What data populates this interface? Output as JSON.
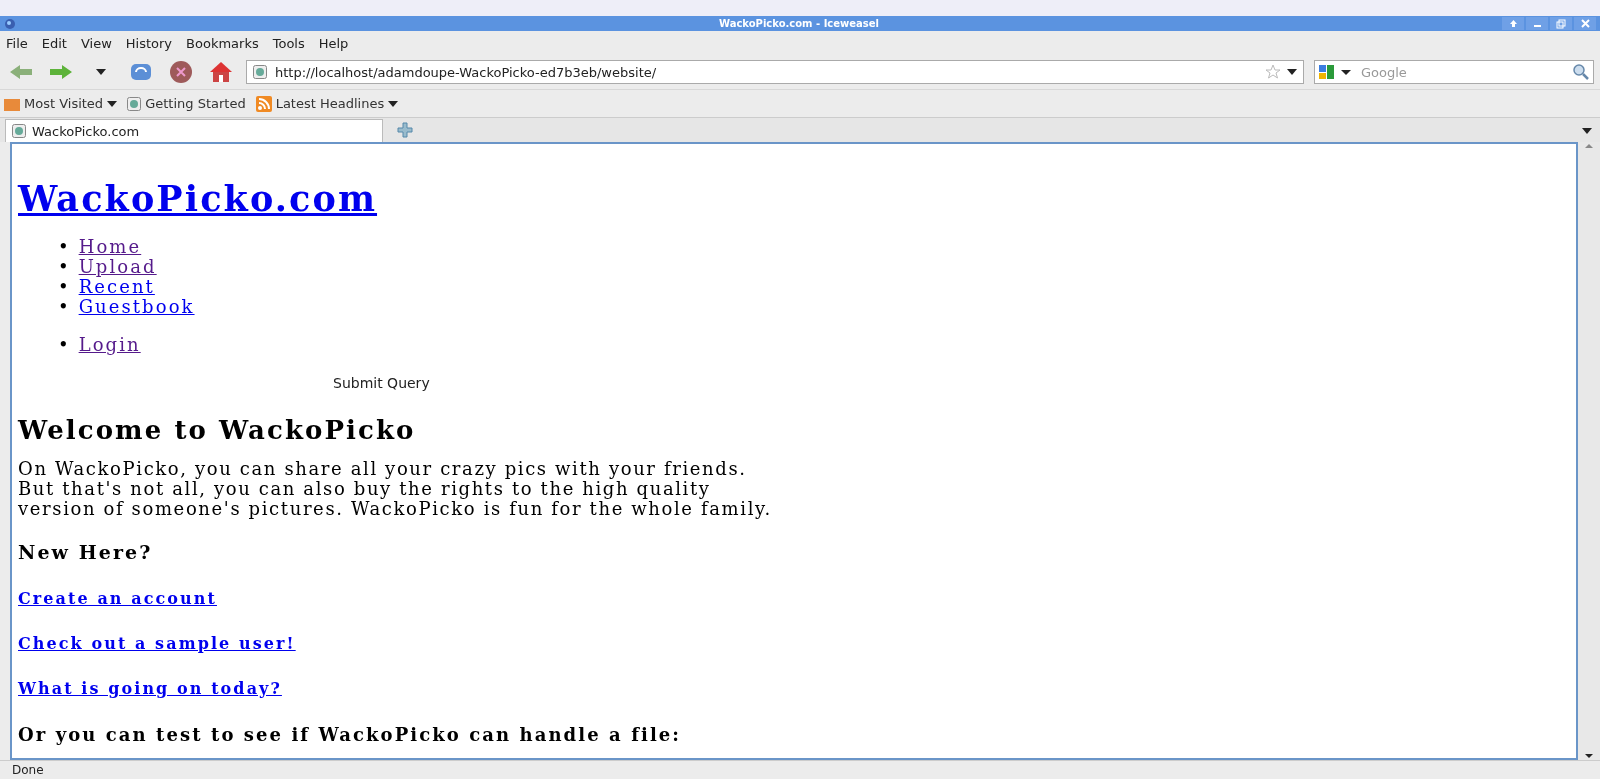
{
  "window": {
    "title": "WackoPicko.com - Iceweasel"
  },
  "menu": [
    "File",
    "Edit",
    "View",
    "History",
    "Bookmarks",
    "Tools",
    "Help"
  ],
  "address": {
    "value": "http://localhost/adamdoupe-WackoPicko-ed7b3eb/website/"
  },
  "search": {
    "placeholder": "Google"
  },
  "bookmarks": [
    {
      "label": "Most Visited",
      "kind": "folder"
    },
    {
      "label": "Getting Started",
      "kind": "page"
    },
    {
      "label": "Latest Headlines",
      "kind": "feed"
    }
  ],
  "tabs": [
    {
      "label": "WackoPicko.com",
      "selected": true
    }
  ],
  "page": {
    "site_title": "WackoPicko.com",
    "nav": [
      {
        "bullet": "•",
        "label": "Home",
        "visited": true
      },
      {
        "bullet": "•",
        "label": "Upload",
        "visited": true
      },
      {
        "bullet": "•",
        "label": "Recent",
        "visited": false
      },
      {
        "bullet": "•",
        "label": "Guestbook",
        "visited": false
      }
    ],
    "login": [
      {
        "bullet": "•",
        "label": "Login",
        "visited": true
      }
    ],
    "submit_button": "Submit Query",
    "heading": "Welcome to WackoPicko",
    "intro": [
      "On WackoPicko, you can share all your crazy pics with your friends.",
      "But that's not all, you can also buy the rights to the high quality",
      "version of someone's pictures. WackoPicko is fun for the whole family."
    ],
    "new_here": "New Here?",
    "links": [
      "Create an account",
      "Check out a sample user!",
      "What is going on today?"
    ],
    "test_heading": "Or you can test to see if WackoPicko can handle a file:"
  },
  "status_bar": {
    "text": "Done"
  }
}
